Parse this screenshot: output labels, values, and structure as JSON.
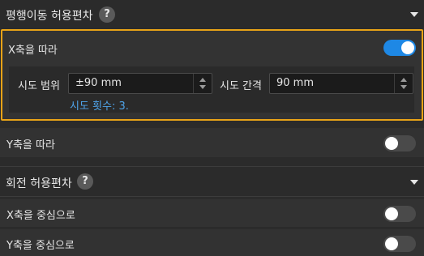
{
  "translation_section": {
    "title": "평행이동 허용편차",
    "help_icon": "?",
    "expanded": true
  },
  "along_x": {
    "label": "X축을 따라",
    "toggle_on": true,
    "range_label": "시도 범위",
    "range_value": "±90 mm",
    "interval_label": "시도 간격",
    "interval_value": "90 mm",
    "count_text": "시도 횟수: 3."
  },
  "along_y": {
    "label": "Y축을 따라",
    "toggle_on": false
  },
  "rotation_section": {
    "title": "회전 허용편차",
    "help_icon": "?",
    "expanded": true
  },
  "around_x": {
    "label": "X축을 중심으로",
    "toggle_on": false
  },
  "around_y": {
    "label": "Y축을 중심으로",
    "toggle_on": false
  },
  "colors": {
    "highlight": "#e8a317",
    "toggle_on": "#1e88e5",
    "count_text": "#4fa3e8"
  }
}
